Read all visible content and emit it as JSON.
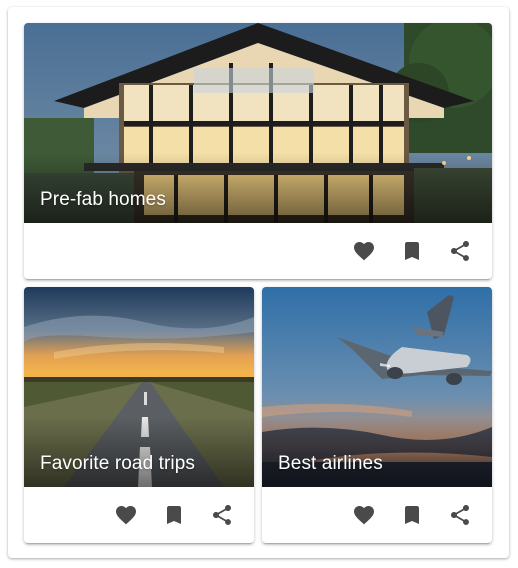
{
  "cards": [
    {
      "title": "Pre-fab homes",
      "image": "modern-glass-house-photo",
      "actions": [
        "heart-icon",
        "bookmark-icon",
        "share-icon"
      ]
    },
    {
      "title": "Favorite road trips",
      "image": "sunset-road-photo",
      "actions": [
        "heart-icon",
        "bookmark-icon",
        "share-icon"
      ]
    },
    {
      "title": "Best airlines",
      "image": "airplane-sunset-photo",
      "actions": [
        "heart-icon",
        "bookmark-icon",
        "share-icon"
      ]
    }
  ],
  "colors": {
    "icon": "#4a4a4a",
    "title_text": "#ffffff",
    "card_bg": "#ffffff"
  }
}
